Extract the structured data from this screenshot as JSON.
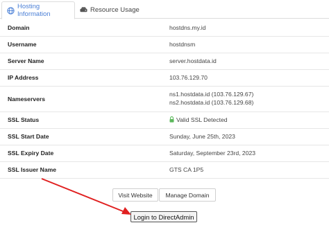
{
  "tabs": [
    {
      "label": "Hosting Information",
      "icon": "globe-icon",
      "active": true
    },
    {
      "label": "Resource Usage",
      "icon": "hdd-icon",
      "active": false
    }
  ],
  "rows": [
    {
      "label": "Domain",
      "value": "hostdns.my.id"
    },
    {
      "label": "Username",
      "value": "hostdnsm"
    },
    {
      "label": "Server Name",
      "value": "server.hostdata.id"
    },
    {
      "label": "IP Address",
      "value": "103.76.129.70"
    },
    {
      "label": "Nameservers",
      "value": "ns1.hostdata.id (103.76.129.67)",
      "value2": "ns2.hostdata.id (103.76.129.68)"
    },
    {
      "label": "SSL Status",
      "value": "Valid SSL Detected",
      "icon": "lock-icon",
      "icon_color": "#5cb85c"
    },
    {
      "label": "SSL Start Date",
      "value": "Sunday, June 25th, 2023"
    },
    {
      "label": "SSL Expiry Date",
      "value": "Saturday, September 23rd, 2023"
    },
    {
      "label": "SSL Issuer Name",
      "value": "GTS CA 1P5"
    }
  ],
  "buttons": {
    "visit": "Visit Website",
    "manage": "Manage Domain",
    "login": "Login to DirectAdmin"
  },
  "colors": {
    "accent": "#4a7fd6",
    "annotation_arrow": "#e02020"
  }
}
